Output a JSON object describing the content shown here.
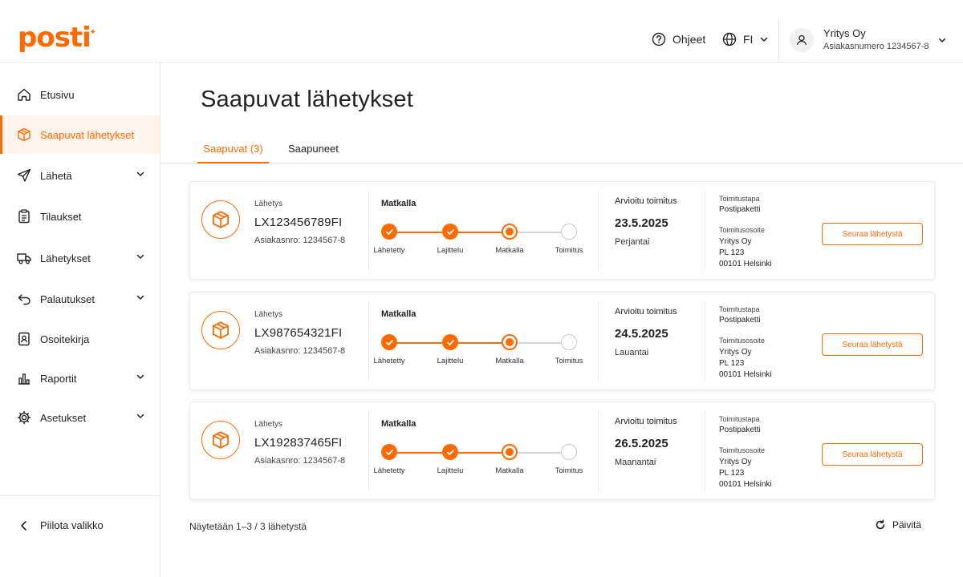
{
  "brand": {
    "logo_text": "posti",
    "accent": "#ff6a00"
  },
  "header": {
    "help_label": "Ohjeet",
    "lang_label": "FI",
    "account_name": "Yritys Oy",
    "account_number": "Asiakasnumero 1234567-8"
  },
  "sidebar": {
    "items": [
      {
        "label": "Etusivu",
        "icon": "home-icon",
        "expandable": false,
        "active": false
      },
      {
        "label": "Saapuvat lähetykset",
        "icon": "package-icon",
        "expandable": false,
        "active": true
      },
      {
        "label": "Lähetä",
        "icon": "send-icon",
        "expandable": true,
        "active": false
      },
      {
        "label": "Tilaukset",
        "icon": "clipboard-icon",
        "expandable": false,
        "active": false
      },
      {
        "label": "Lähetykset",
        "icon": "truck-icon",
        "expandable": true,
        "active": false
      },
      {
        "label": "Palautukset",
        "icon": "return-icon",
        "expandable": true,
        "active": false
      },
      {
        "label": "Osoitekirja",
        "icon": "address-book-icon",
        "expandable": false,
        "active": false
      },
      {
        "label": "Raportit",
        "icon": "bar-chart-icon",
        "expandable": true,
        "active": false
      },
      {
        "label": "Asetukset",
        "icon": "gear-icon",
        "expandable": true,
        "active": false
      }
    ],
    "collapse_label": "Piilota valikko"
  },
  "main": {
    "title": "Saapuvat lähetykset",
    "tabs": [
      {
        "label": "Saapuvat (3)",
        "active": true
      },
      {
        "label": "Saapuneet",
        "active": false
      }
    ],
    "shipments": [
      {
        "label": "Lähetys",
        "id": "LX123456789FI",
        "customer": "Asiakasnro: 1234567-8",
        "status": "Matkalla",
        "steps": [
          "Lähetetty",
          "Lajittelu",
          "Matkalla",
          "Toimitus"
        ],
        "current_step": 2,
        "eta_label": "Arvioitu toimitus",
        "eta_date": "23.5.2025",
        "eta_day": "Perjantai",
        "delivery_method_label": "Toimitustapa",
        "delivery_method": "Postipaketti",
        "address_label": "Toimitusosoite",
        "address_lines": [
          "Yritys Oy",
          "PL 123",
          "00101 Helsinki"
        ],
        "track_label": "Seuraa lähetystä"
      },
      {
        "label": "Lähetys",
        "id": "LX987654321FI",
        "customer": "Asiakasnro: 1234567-8",
        "status": "Matkalla",
        "steps": [
          "Lähetetty",
          "Lajittelu",
          "Matkalla",
          "Toimitus"
        ],
        "current_step": 2,
        "eta_label": "Arvioitu toimitus",
        "eta_date": "24.5.2025",
        "eta_day": "Lauantai",
        "delivery_method_label": "Toimitustapa",
        "delivery_method": "Postipaketti",
        "address_label": "Toimitusosoite",
        "address_lines": [
          "Yritys Oy",
          "PL 123",
          "00101 Helsinki"
        ],
        "track_label": "Seuraa lähetystä"
      },
      {
        "label": "Lähetys",
        "id": "LX192837465FI",
        "customer": "Asiakasnro: 1234567-8",
        "status": "Matkalla",
        "steps": [
          "Lähetetty",
          "Lajittelu",
          "Matkalla",
          "Toimitus"
        ],
        "current_step": 2,
        "eta_label": "Arvioitu toimitus",
        "eta_date": "26.5.2025",
        "eta_day": "Maanantai",
        "delivery_method_label": "Toimitustapa",
        "delivery_method": "Postipaketti",
        "address_label": "Toimitusosoite",
        "address_lines": [
          "Yritys Oy",
          "PL 123",
          "00101 Helsinki"
        ],
        "track_label": "Seuraa lähetystä"
      }
    ],
    "footer_text": "Näytetään 1–3 / 3 lähetystä",
    "refresh_label": "Päivitä"
  }
}
